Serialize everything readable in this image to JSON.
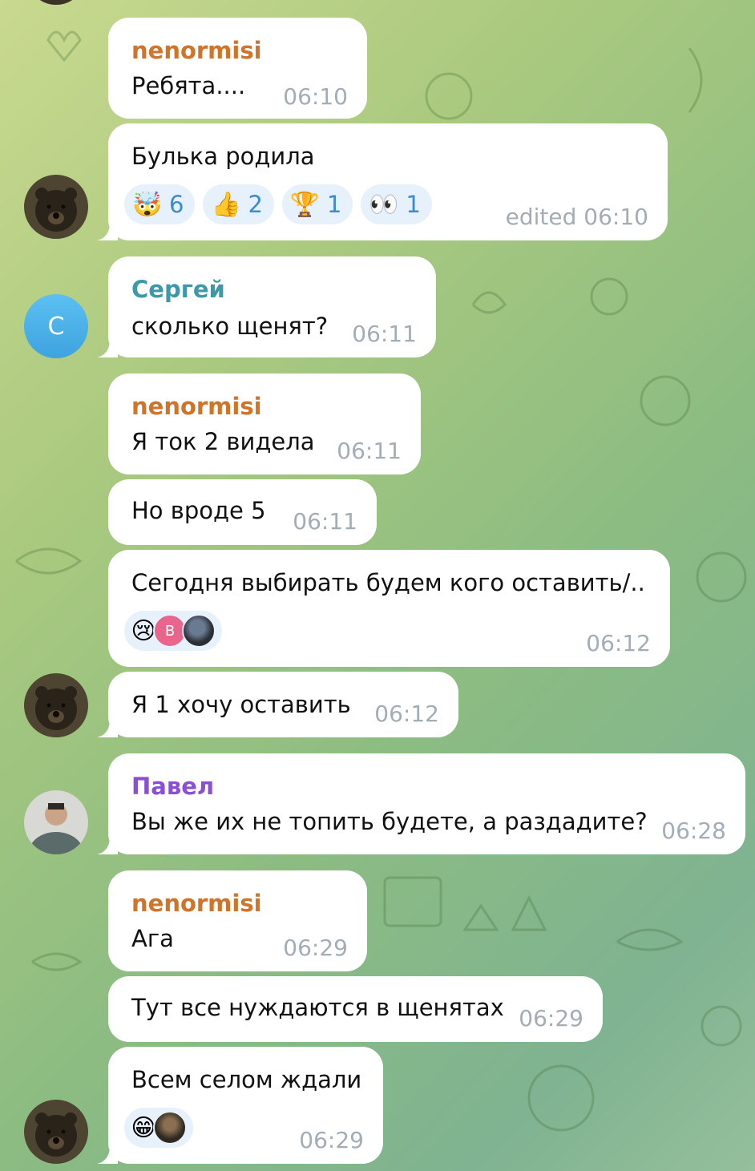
{
  "messages": [
    {
      "sender": "nenormisi",
      "sender_color": "#d0742a",
      "text": "Ребята....",
      "time": "06:10"
    },
    {
      "text": "Булька родила",
      "time": "edited 06:10",
      "reactions": [
        {
          "icon": "exploding-head-emoji",
          "glyph": "🤯",
          "count": "6"
        },
        {
          "icon": "thumbs-up-emoji",
          "glyph": "👍",
          "count": "2"
        },
        {
          "icon": "trophy-emoji",
          "glyph": "🏆",
          "count": "1"
        },
        {
          "icon": "eyes-emoji",
          "glyph": "👀",
          "count": "1"
        }
      ]
    },
    {
      "sender": "Сергей",
      "sender_color": "#3d98a8",
      "avatar_letter": "С",
      "text": "сколько щенят?",
      "time": "06:11"
    },
    {
      "sender": "nenormisi",
      "sender_color": "#d0742a",
      "text": "Я ток 2 видела",
      "time": "06:11"
    },
    {
      "text": "Но вроде 5",
      "time": "06:11"
    },
    {
      "text": "Сегодня выбирать будем кого оставить/..",
      "time": "06:12",
      "reaction": {
        "icon": "crying-face-emoji",
        "glyph": "😢",
        "avatar_letter": "В"
      }
    },
    {
      "text": "Я 1 хочу оставить",
      "time": "06:12"
    },
    {
      "sender": "Павел",
      "sender_color": "#8b4fd6",
      "text": "Вы же их не топить будете, а раздадите?",
      "time": "06:28"
    },
    {
      "sender": "nenormisi",
      "sender_color": "#d0742a",
      "text": "Ага",
      "time": "06:29"
    },
    {
      "text": "Тут все нуждаются в щенятах",
      "time": "06:29"
    },
    {
      "text": "Всем селом ждали",
      "time": "06:29",
      "reaction": {
        "icon": "grinning-face-emoji",
        "glyph": "😁"
      }
    }
  ]
}
